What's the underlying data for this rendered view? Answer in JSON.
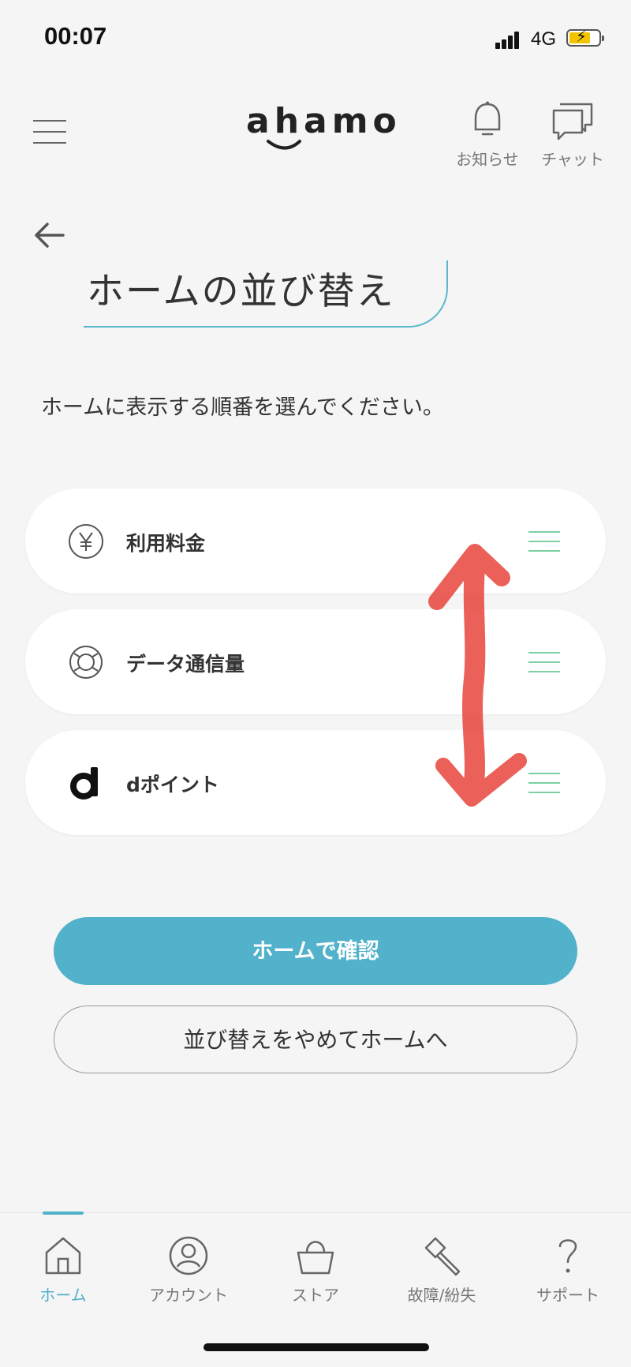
{
  "status_bar": {
    "time": "00:07",
    "network": "4G",
    "icons": [
      "signal-icon",
      "battery-charging-icon"
    ]
  },
  "header": {
    "menu_icon": "hamburger-menu-icon",
    "logo_text": "ahamo",
    "actions": [
      {
        "label": "お知らせ",
        "icon": "bell-icon"
      },
      {
        "label": "チャット",
        "icon": "chat-icon"
      }
    ]
  },
  "page": {
    "back_icon": "arrow-left-icon",
    "title": "ホームの並び替え",
    "instruction": "ホームに表示する順番を選んでください。"
  },
  "items": [
    {
      "label": "利用料金",
      "icon": "yen-icon"
    },
    {
      "label": "データ通信量",
      "icon": "data-usage-icon"
    },
    {
      "label": "dポイント",
      "icon": "d-point-icon"
    }
  ],
  "buttons": {
    "confirm": "ホームで確認",
    "cancel": "並び替えをやめてホームへ"
  },
  "bottom_nav": {
    "active": "ホーム",
    "tabs": [
      {
        "label": "ホーム",
        "icon": "home-icon"
      },
      {
        "label": "アカウント",
        "icon": "account-icon"
      },
      {
        "label": "ストア",
        "icon": "store-basket-icon"
      },
      {
        "label": "故障/紛失",
        "icon": "hammer-icon"
      },
      {
        "label": "サポート",
        "icon": "question-icon"
      }
    ]
  },
  "colors": {
    "accent": "#52b1cb",
    "handle": "#7dcfa2",
    "annotation": "#e8453c",
    "background": "#f5f5f5"
  }
}
